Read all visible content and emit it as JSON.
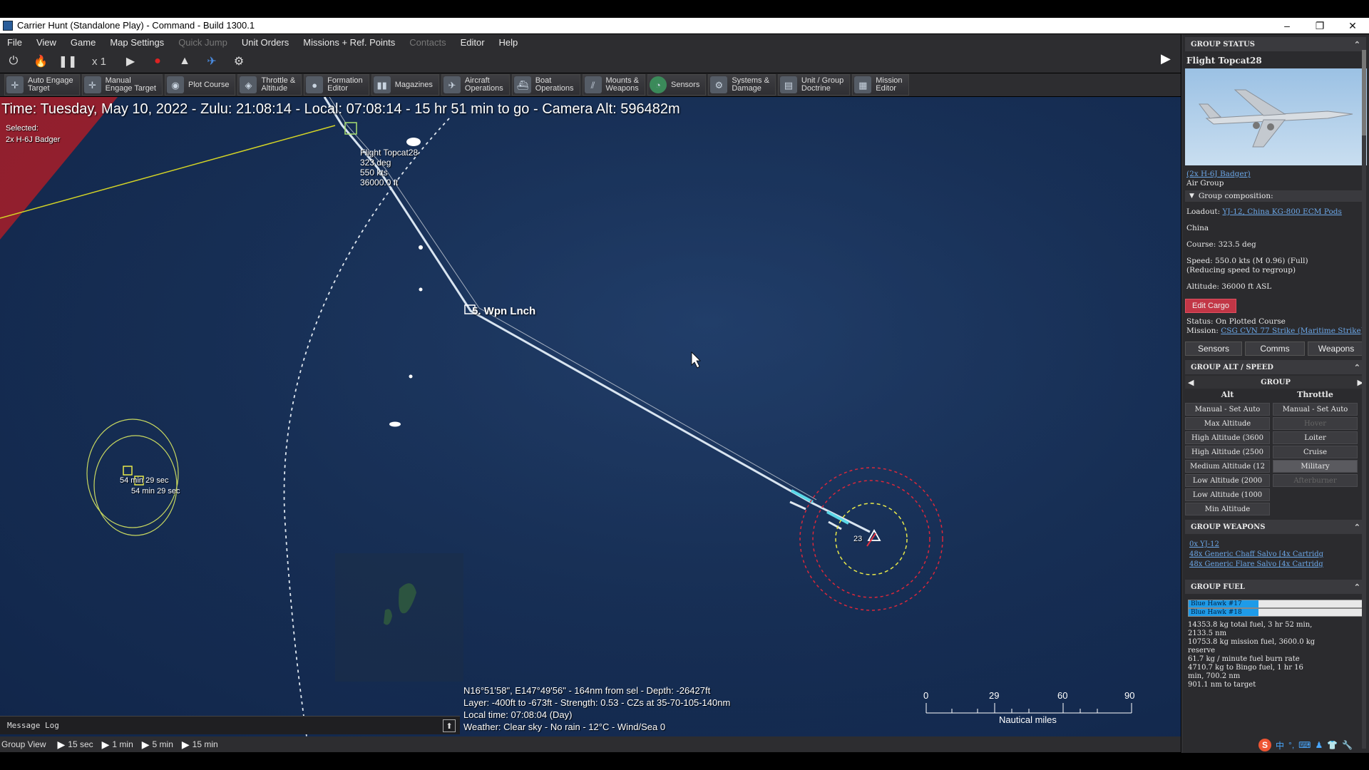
{
  "window": {
    "title": "Carrier Hunt (Standalone Play) - Command - Build 1300.1",
    "controls": [
      "–",
      "❐",
      "✕"
    ]
  },
  "menu": {
    "items": [
      {
        "label": "File",
        "enabled": true
      },
      {
        "label": "View",
        "enabled": true
      },
      {
        "label": "Game",
        "enabled": true
      },
      {
        "label": "Map Settings",
        "enabled": true
      },
      {
        "label": "Quick Jump",
        "enabled": false
      },
      {
        "label": "Unit Orders",
        "enabled": true
      },
      {
        "label": "Missions + Ref. Points",
        "enabled": true
      },
      {
        "label": "Contacts",
        "enabled": false
      },
      {
        "label": "Editor",
        "enabled": true
      },
      {
        "label": "Help",
        "enabled": true
      }
    ]
  },
  "sim_controls": {
    "clock_icon": "clock-icon",
    "fire_icon": "fire-icon",
    "pause_icon": "pause-icon",
    "speed_label": "x 1",
    "play_icon": "play-icon",
    "record_icon": "record-icon"
  },
  "toolbar": {
    "buttons": [
      {
        "label": "Auto Engage\nTarget",
        "icon": "auto-engage-icon"
      },
      {
        "label": "Manual\nEngage Target",
        "icon": "manual-engage-icon"
      },
      {
        "label": "Plot Course",
        "icon": "plot-course-icon"
      },
      {
        "label": "Throttle &\nAltitude",
        "icon": "throttle-icon"
      },
      {
        "label": "Formation\nEditor",
        "icon": "formation-icon"
      },
      {
        "label": "Magazines",
        "icon": "magazines-icon"
      },
      {
        "label": "Aircraft\nOperations",
        "icon": "aircraft-icon"
      },
      {
        "label": "Boat\nOperations",
        "icon": "boat-icon"
      },
      {
        "label": "Mounts &\nWeapons",
        "icon": "mounts-icon"
      },
      {
        "label": "Sensors",
        "icon": "sensors-icon"
      },
      {
        "label": "Systems &\nDamage",
        "icon": "systems-icon"
      },
      {
        "label": "Unit / Group\nDoctrine",
        "icon": "doctrine-icon"
      },
      {
        "label": "Mission\nEditor",
        "icon": "mission-editor-icon"
      }
    ]
  },
  "map": {
    "time_readout": "Time: Tuesday, May 10, 2022 - Zulu: 21:08:14 - Local: 07:08:14 - 15 hr 51 min to go -  Camera Alt: 596482m",
    "selected_label": "Selected:",
    "selected_unit": "2x H-6J Badger",
    "unit_label": {
      "name": "Flight Topcat28",
      "course": "323 deg",
      "speed": "550 kts",
      "alt": "36000.0 ft"
    },
    "waypoint_label": "5. Wpn Lnch",
    "contact_time_1": "54 min 29 sec",
    "contact_time_2": "54 min 29 sec",
    "target_number": "23",
    "cursor_info": [
      "N16°51'58\", E147°49'56\" - 164nm from sel - Depth: -26427ft",
      "Layer: -400ft to -673ft - Strength: 0.53 - CZs at 35-70-105-140nm",
      "Local time: 07:08:04 (Day)",
      "Weather: Clear sky - No rain - 12°C - Wind/Sea 0"
    ],
    "scale": {
      "ticks": [
        "0",
        "29",
        "60",
        "90"
      ],
      "unit": "Nautical miles"
    }
  },
  "message_log": {
    "label": "Message Log"
  },
  "bottom_bar": {
    "view_label": "Group View",
    "steps": [
      "15 sec",
      "1 min",
      "5 min",
      "15 min"
    ]
  },
  "group_status": {
    "header": "GROUP STATUS",
    "name": "Flight Topcat28",
    "type_link": "(2x H-6J Badger)",
    "type": "Air Group",
    "composition_label": "Group composition:",
    "loadout_label": "Loadout:",
    "loadout_value": "YJ-12, China KG-800 ECM Pods",
    "country": "China",
    "course": "Course: 323.5 deg",
    "speed": "Speed: 550.0 kts (M 0.96) (Full)",
    "speed_note": "(Reducing speed to regroup)",
    "altitude": "Altitude: 36000 ft ASL",
    "edit_cargo": "Edit Cargo",
    "status": "Status: On Plotted Course",
    "mission_label": "Mission:",
    "mission_value": "CSG CVN 77 Strike (Maritime Strike)",
    "buttons": [
      "Sensors",
      "Comms",
      "Weapons"
    ]
  },
  "alt_speed": {
    "header": "GROUP ALT / SPEED",
    "group_label": "GROUP",
    "alt_col": "Alt",
    "throttle_col": "Throttle",
    "alt_items": [
      "Manual - Set Auto",
      "Max Altitude",
      "High Altitude (3600",
      "High Altitude (2500",
      "Medium Altitude (12",
      "Low Altitude (2000",
      "Low Altitude (1000",
      "Min Altitude"
    ],
    "throttle_items": [
      "Manual - Set Auto",
      "Hover",
      "Loiter",
      "Cruise",
      "Military",
      "Afterburner"
    ]
  },
  "weapons": {
    "header": "GROUP WEAPONS",
    "items": [
      "0x YJ-12",
      "48x Generic Chaff Salvo [4x Cartridg",
      "48x Generic Flare Salvo [4x Cartridg"
    ]
  },
  "fuel": {
    "header": "GROUP FUEL",
    "bars": [
      {
        "label": "Blue Hawk #17",
        "level": 0.4
      },
      {
        "label": "Blue Hawk #18",
        "level": 0.4
      }
    ],
    "lines": [
      "14353.8 kg total fuel, 3 hr 52 min,",
      "2133.5 nm",
      "10753.8 kg mission fuel, 3600.0 kg",
      "reserve",
      "61.7 kg / minute fuel burn rate",
      "4710.7 kg to Bingo fuel, 1 hr 16",
      "min, 700.2 nm",
      "901.1 nm to target"
    ]
  },
  "colors": {
    "ocean": "#172f56",
    "range_red": "#d9283b",
    "range_yellow": "#e8e84a",
    "flight_path": "#d8e4f0",
    "bingo_line": "#d4d426",
    "threat_zone": "#b8202c",
    "link": "#6ba6e6"
  }
}
